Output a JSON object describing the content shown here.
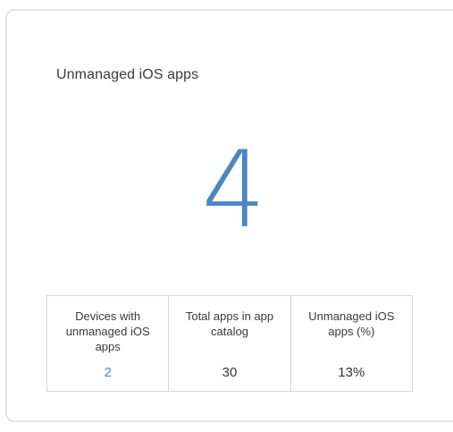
{
  "widget": {
    "title": "Unmanaged iOS apps",
    "big_value": "4"
  },
  "stats": [
    {
      "label": "Devices with unmanaged iOS apps",
      "value": "2"
    },
    {
      "label": "Total apps in app catalog",
      "value": "30"
    },
    {
      "label": "Unmanaged iOS apps (%)",
      "value": "13%"
    }
  ],
  "colors": {
    "accent": "#4a86c6",
    "border": "#d8d8d8",
    "text": "#3a3a3a"
  }
}
